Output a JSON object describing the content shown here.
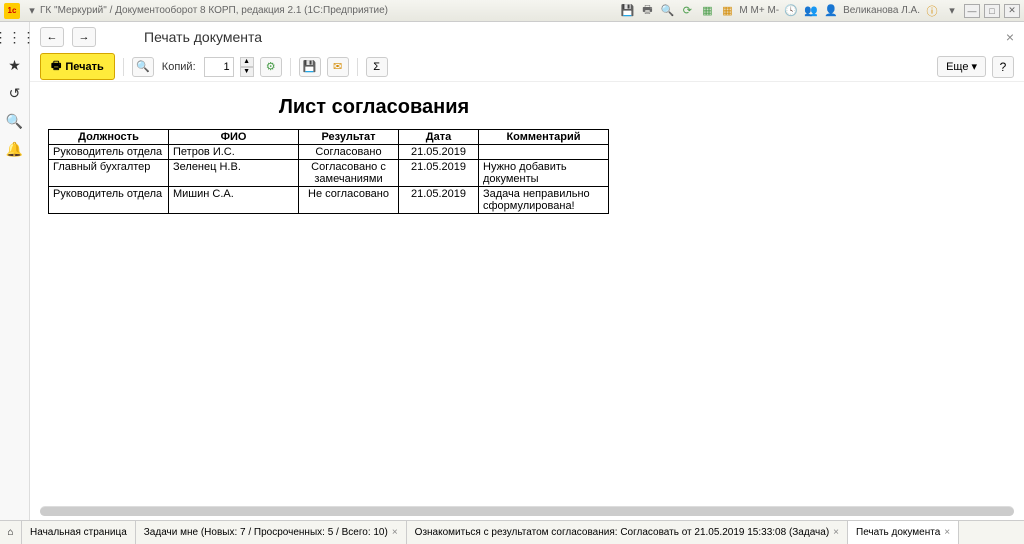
{
  "titlebar": {
    "app_title": "ГК \"Меркурий\" / Документооборот 8 КОРП, редакция 2.1  (1С:Предприятие)",
    "user": "Великанова Л.А."
  },
  "page": {
    "title": "Печать документа"
  },
  "toolbar": {
    "print_label": "Печать",
    "copies_label": "Копий:",
    "copies_value": "1",
    "more_label": "Еще",
    "help_label": "?"
  },
  "document": {
    "title": "Лист согласования",
    "headers": {
      "position": "Должность",
      "name": "ФИО",
      "result": "Результат",
      "date": "Дата",
      "comment": "Комментарий"
    },
    "rows": [
      {
        "position": "Руководитель отдела",
        "name": "Петров И.С.",
        "result": "Согласовано",
        "date": "21.05.2019",
        "comment": ""
      },
      {
        "position": "Главный бухгалтер",
        "name": "Зеленец Н.В.",
        "result": "Согласовано с замечаниями",
        "date": "21.05.2019",
        "comment": "Нужно добавить документы"
      },
      {
        "position": "Руководитель отдела",
        "name": "Мишин С.А.",
        "result": "Не согласовано",
        "date": "21.05.2019",
        "comment": "Задача неправильно сформулирована!"
      }
    ]
  },
  "tabs": {
    "home": "Начальная страница",
    "tasks": "Задачи мне (Новых: 7 / Просроченных: 5 / Всего: 10)",
    "approval": "Ознакомиться с результатом согласования: Согласовать от 21.05.2019 15:33:08 (Задача)",
    "print": "Печать документа"
  }
}
